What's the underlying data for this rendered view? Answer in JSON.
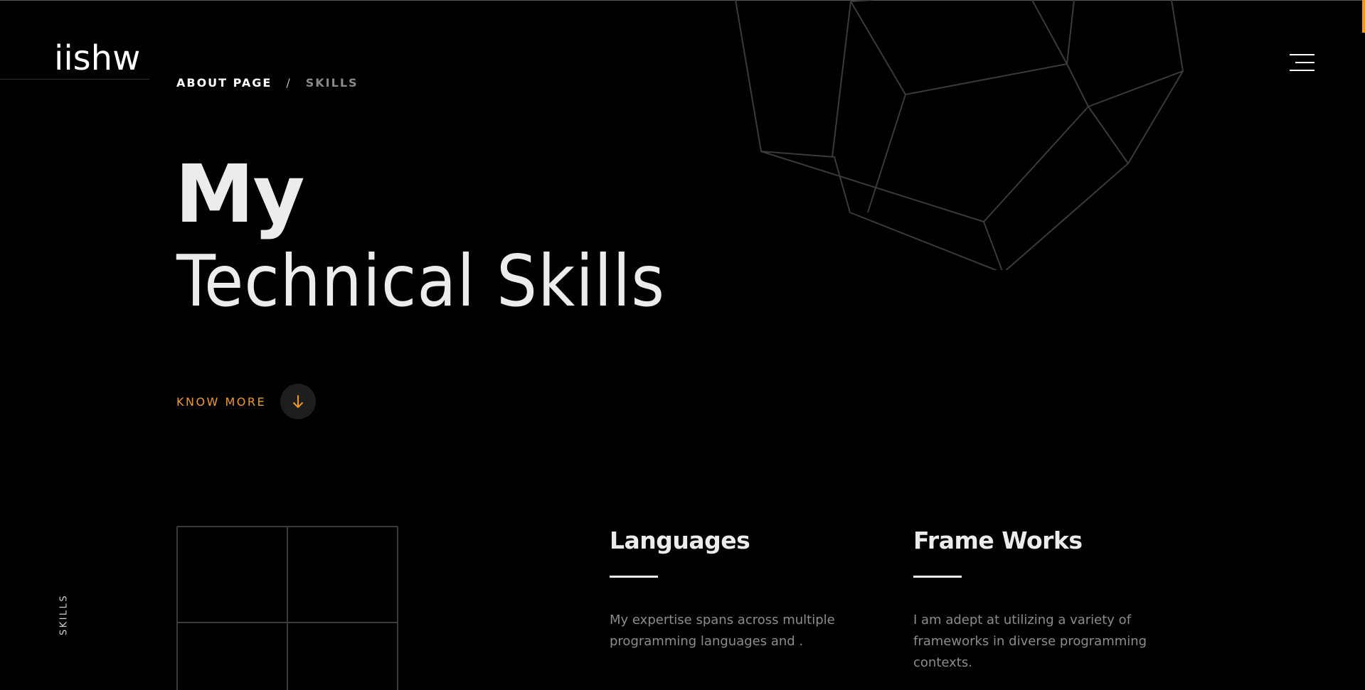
{
  "brand": {
    "logo_text": "iishw",
    "accent_color": "#f39a1e"
  },
  "breadcrumb": {
    "items": [
      "ABOUT PAGE",
      "SKILLS"
    ],
    "separator": "/"
  },
  "header": {
    "menu_icon": "hamburger-menu-icon"
  },
  "hero": {
    "title_line1": "My",
    "title_line2": "Technical Skills",
    "cta_label": "KNOW MORE",
    "cta_icon": "arrow-down-icon"
  },
  "side_label": "SKILLS",
  "cards": [
    {
      "title": "Languages",
      "description": "My expertise spans across multiple programming languages and ."
    },
    {
      "title": "Frame Works",
      "description": "I am adept at utilizing a variety of frameworks in diverse programming contexts."
    }
  ]
}
